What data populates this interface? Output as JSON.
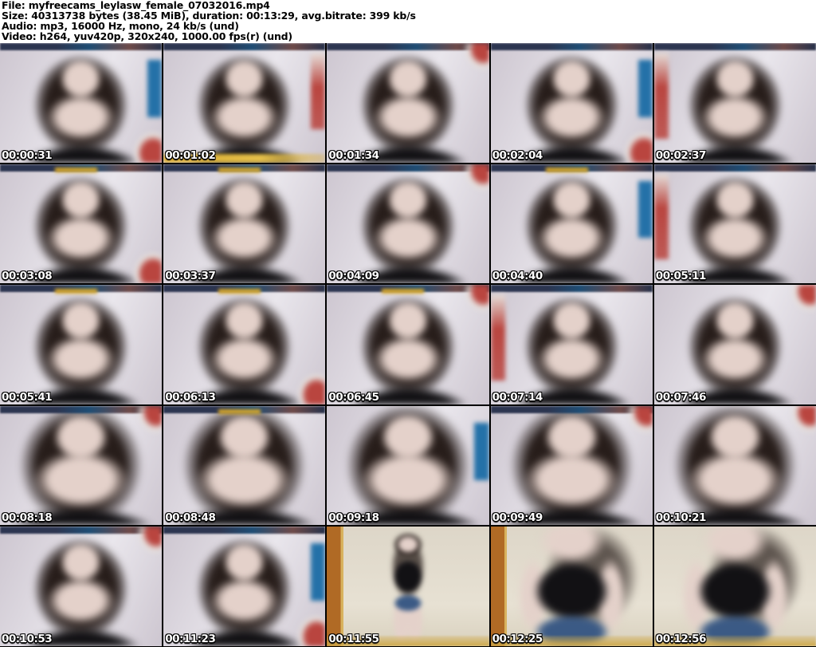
{
  "header": {
    "file_line": "File: myfreecams_leylasw_female_07032016.mp4",
    "size_line": "Size: 40313738 bytes (38.45 MiB), duration: 00:13:29, avg.bitrate: 399 kb/s",
    "audio_line": "Audio: mp3, 16000 Hz, mono, 24 kb/s (und)",
    "video_line": "Video: h264, yuv420p, 320x240, 1000.00 fps(r) (und)"
  },
  "colors": {
    "wall": "#cdc6d0",
    "wall_bright": "#e9e6ec",
    "hair": "#271d1a",
    "skin": "#e4d1ca",
    "garment": "#121114",
    "denim": "#3b5a85",
    "bed_red": "#b9453f",
    "couch_blue": "#2471a8",
    "strip_yellow": "#d8a82c",
    "door_orange": "#b06a25",
    "floor_yellow": "#cfa94a",
    "timestamp_text": "#ffffff",
    "timestamp_outline": "#000000"
  },
  "thumbnails": [
    {
      "timestamp": "00:00:31",
      "variant": "bust",
      "bg": "room",
      "accents": [
        "top-dark",
        "blue-r",
        "red-br"
      ]
    },
    {
      "timestamp": "00:01:02",
      "variant": "bust",
      "bg": "room",
      "accents": [
        "top-dark",
        "red-r",
        "yellow-b"
      ]
    },
    {
      "timestamp": "00:01:34",
      "variant": "bust",
      "bg": "room",
      "accents": [
        "top-dark",
        "red-tr"
      ]
    },
    {
      "timestamp": "00:02:04",
      "variant": "bust",
      "bg": "room",
      "accents": [
        "top-dark",
        "blue-r",
        "red-br"
      ]
    },
    {
      "timestamp": "00:02:37",
      "variant": "bust",
      "bg": "room",
      "accents": [
        "top-dark",
        "red-l"
      ]
    },
    {
      "timestamp": "00:03:08",
      "variant": "bust",
      "bg": "room",
      "accents": [
        "top-dark",
        "yellow-t",
        "red-br"
      ]
    },
    {
      "timestamp": "00:03:37",
      "variant": "bust",
      "bg": "room",
      "accents": [
        "top-dark",
        "yellow-t"
      ]
    },
    {
      "timestamp": "00:04:09",
      "variant": "bust",
      "bg": "room",
      "accents": [
        "top-dark",
        "red-tr"
      ]
    },
    {
      "timestamp": "00:04:40",
      "variant": "bust",
      "bg": "room",
      "accents": [
        "top-dark",
        "yellow-t",
        "blue-r"
      ]
    },
    {
      "timestamp": "00:05:11",
      "variant": "bust",
      "bg": "room",
      "accents": [
        "top-dark",
        "red-l"
      ]
    },
    {
      "timestamp": "00:05:41",
      "variant": "bust",
      "bg": "room",
      "accents": [
        "top-dark",
        "yellow-t"
      ]
    },
    {
      "timestamp": "00:06:13",
      "variant": "bust",
      "bg": "room",
      "accents": [
        "top-dark",
        "yellow-t",
        "red-br"
      ]
    },
    {
      "timestamp": "00:06:45",
      "variant": "bust",
      "bg": "room",
      "accents": [
        "top-dark",
        "yellow-t",
        "red-tr"
      ]
    },
    {
      "timestamp": "00:07:14",
      "variant": "bust",
      "bg": "room",
      "accents": [
        "top-dark",
        "red-l"
      ]
    },
    {
      "timestamp": "00:07:46",
      "variant": "bust",
      "bg": "room",
      "accents": [
        "red-tr"
      ]
    },
    {
      "timestamp": "00:08:18",
      "variant": "bust-close",
      "bg": "room",
      "accents": [
        "top-dark",
        "red-tr"
      ]
    },
    {
      "timestamp": "00:08:48",
      "variant": "bust-close",
      "bg": "room",
      "accents": [
        "top-dark",
        "yellow-t"
      ]
    },
    {
      "timestamp": "00:09:18",
      "variant": "bust-close",
      "bg": "room",
      "accents": [
        "blue-r"
      ]
    },
    {
      "timestamp": "00:09:49",
      "variant": "bust-close",
      "bg": "room",
      "accents": [
        "top-dark",
        "red-tr"
      ]
    },
    {
      "timestamp": "00:10:21",
      "variant": "bust-close",
      "bg": "room",
      "accents": [
        "red-tr"
      ]
    },
    {
      "timestamp": "00:10:53",
      "variant": "bust",
      "bg": "room",
      "accents": [
        "top-dark",
        "red-tr"
      ]
    },
    {
      "timestamp": "00:11:23",
      "variant": "bust",
      "bg": "room",
      "accents": [
        "top-dark",
        "blue-r",
        "red-br"
      ]
    },
    {
      "timestamp": "00:11:55",
      "variant": "standing",
      "bg": "hall",
      "accents": [
        "door-l",
        "floor-b"
      ]
    },
    {
      "timestamp": "00:12:25",
      "variant": "standing-close",
      "bg": "hall",
      "accents": [
        "door-l",
        "floor-b"
      ]
    },
    {
      "timestamp": "00:12:56",
      "variant": "standing-close",
      "bg": "hall",
      "accents": [
        "floor-b"
      ]
    }
  ]
}
